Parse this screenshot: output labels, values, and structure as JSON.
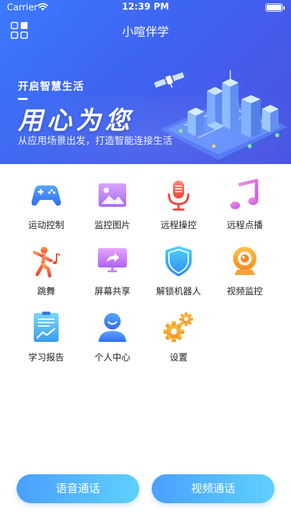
{
  "status_bar": {
    "carrier": "Carrier",
    "time": "12:39 PM",
    "battery_level": 1.0
  },
  "nav": {
    "title": "小喧伴学",
    "menu_icon": "grid-menu-icon"
  },
  "banner": {
    "tagline": "开启智慧生活",
    "slogan": "用心为您",
    "subtitle": "从应用场景出发，打造智能连接生活",
    "illustration": "smart-city-illustration"
  },
  "features": [
    {
      "id": "motion",
      "label": "运动控制",
      "icon": "gamepad-icon"
    },
    {
      "id": "monitor-photos",
      "label": "监控图片",
      "icon": "image-icon"
    },
    {
      "id": "remote-control",
      "label": "远程操控",
      "icon": "microphone-icon"
    },
    {
      "id": "remote-play",
      "label": "远程点播",
      "icon": "music-note-icon"
    },
    {
      "id": "dance",
      "label": "跳舞",
      "icon": "dancer-icon"
    },
    {
      "id": "screen-share",
      "label": "屏幕共享",
      "icon": "screen-share-icon"
    },
    {
      "id": "unlock-robot",
      "label": "解锁机器人",
      "icon": "shield-icon"
    },
    {
      "id": "video-monitor",
      "label": "视频监控",
      "icon": "webcam-icon"
    },
    {
      "id": "study-report",
      "label": "学习报告",
      "icon": "report-chart-icon"
    },
    {
      "id": "profile",
      "label": "个人中心",
      "icon": "user-icon"
    },
    {
      "id": "settings",
      "label": "设置",
      "icon": "gears-icon"
    }
  ],
  "actions": {
    "voice_call": "语音通话",
    "video_call": "视频通话"
  },
  "colors": {
    "banner_start": "#3a7bff",
    "banner_end": "#4b52e4",
    "button_start": "#4aa0ff",
    "button_end": "#5fd0ff"
  }
}
